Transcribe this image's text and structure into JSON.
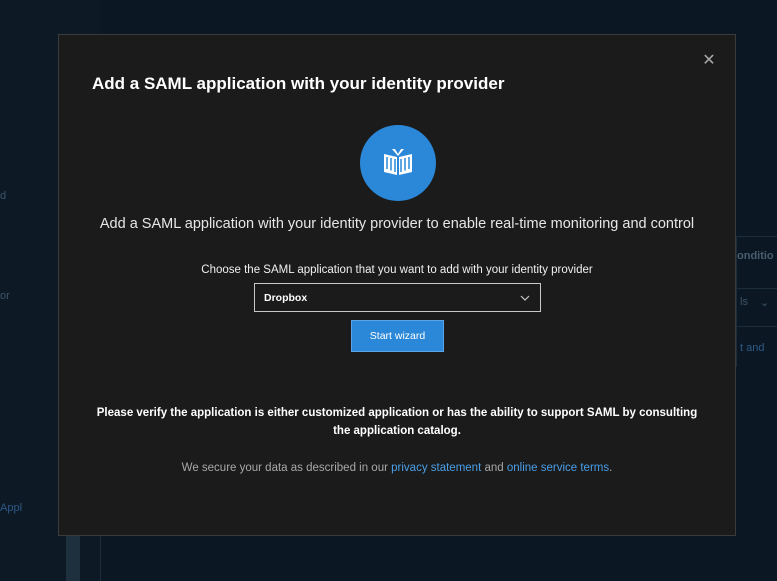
{
  "background": {
    "fragments": [
      "d",
      "or",
      "Appl",
      "onditio",
      "ls",
      "t and"
    ]
  },
  "modal": {
    "close_glyph": "✕",
    "title": "Add a SAML application with your identity provider",
    "icon": "open-book-icon",
    "subtitle": "Add a SAML application with your identity provider to enable real-time monitoring and control",
    "choose_label": "Choose the SAML application that you want to add with your identity provider",
    "dropdown": {
      "selected": "Dropbox"
    },
    "start_button": "Start wizard",
    "verify_note": "Please verify the application is either customized application or has the ability to support SAML by consulting the application catalog.",
    "footer": {
      "prefix": "We secure your data as described in our ",
      "privacy_link": "privacy statement",
      "and": " and ",
      "terms_link": "online service terms",
      "suffix": "."
    }
  },
  "colors": {
    "accent": "#2b88d8",
    "link": "#4a9fe8",
    "modal_bg": "#1b1b1b"
  }
}
